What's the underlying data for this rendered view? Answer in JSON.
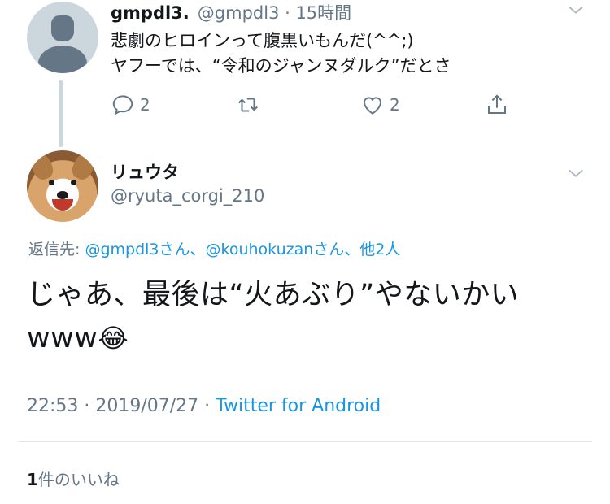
{
  "tweet1": {
    "display_name": "gmpdl3.",
    "handle_time": "@gmpdl3 · 15時間",
    "text": "悲劇のヒロインって腹黒いもんだ(^^;)\nヤフーでは、“令和のジャンヌダルク”だとさ",
    "reply_count": "2",
    "like_count": "2"
  },
  "tweet2": {
    "display_name": "リュウタ",
    "handle": "@ryuta_corgi_210",
    "reply_prefix": "返信先: ",
    "reply_users": "@gmpdl3さん、@kouhokuzanさん、他2人",
    "text": "じゃあ、最後は“火あぶり”やないかい\nwww",
    "emoji": "😂",
    "timestamp": "22:53 · 2019/07/27 · ",
    "source": "Twitter for Android"
  },
  "likes": {
    "count": "1",
    "label": "件のいいね"
  },
  "icons": [
    "chevron-down-icon",
    "reply-icon",
    "retweet-icon",
    "like-icon",
    "share-icon"
  ],
  "colors": {
    "link": "#1b95e0",
    "secondary": "#657786",
    "text": "#14171a",
    "line": "#ccd6dd"
  }
}
